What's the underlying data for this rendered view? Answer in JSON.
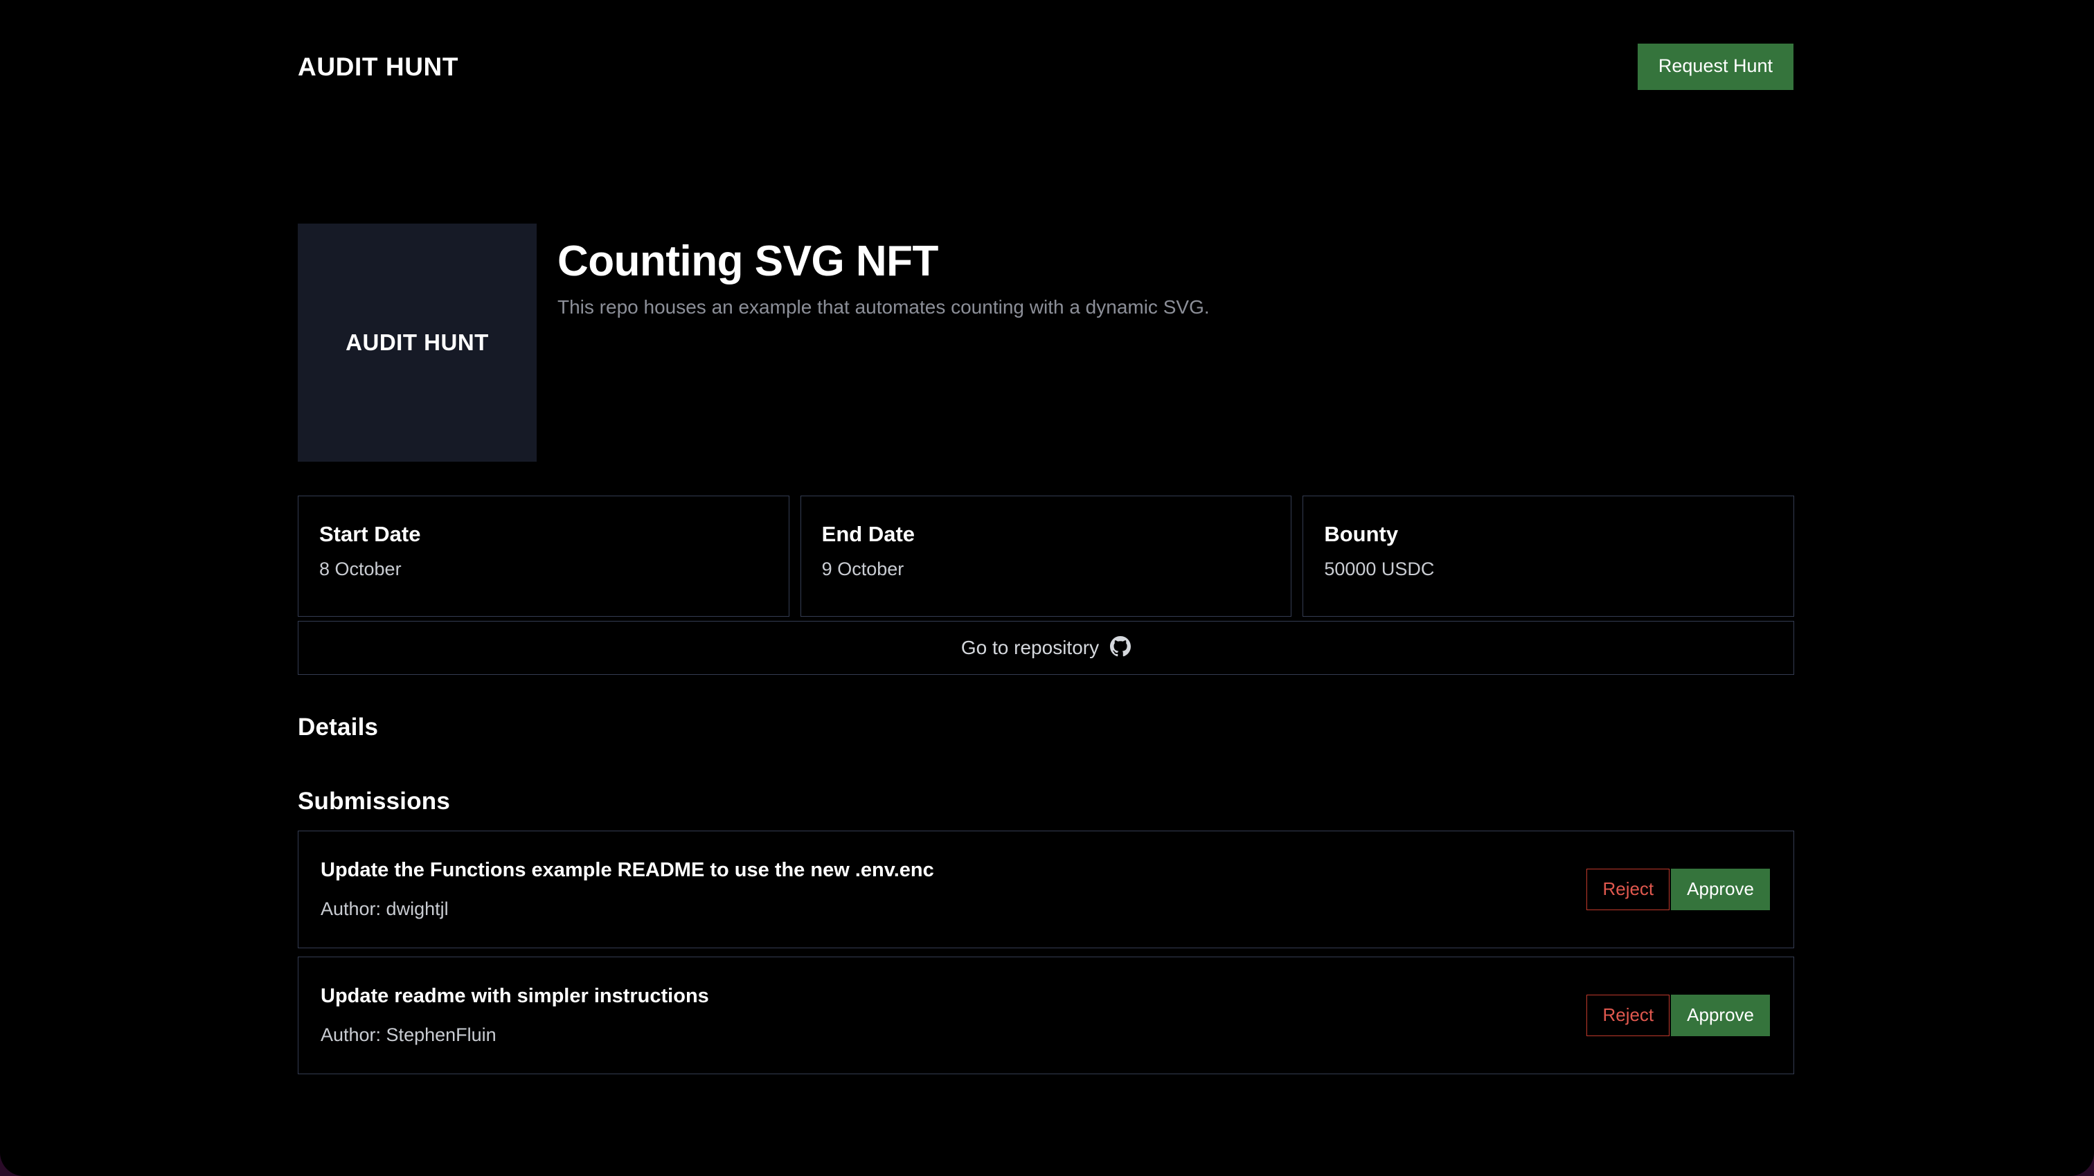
{
  "header": {
    "brand": "AUDIT HUNT",
    "request_hunt_label": "Request Hunt"
  },
  "hero": {
    "thumbnail_text": "AUDIT HUNT",
    "title": "Counting SVG NFT",
    "description": "This repo houses an example that automates counting with a dynamic SVG."
  },
  "meta_cards": [
    {
      "label": "Start Date",
      "value": "8 October"
    },
    {
      "label": "End Date",
      "value": "9 October"
    },
    {
      "label": "Bounty",
      "value": "50000 USDC"
    }
  ],
  "repository": {
    "label": "Go to repository",
    "icon": "github-icon"
  },
  "sections": {
    "details_heading": "Details",
    "submissions_heading": "Submissions"
  },
  "submissions": [
    {
      "title": "Update the Functions example README to use the new .env.enc",
      "author": "Author: dwightjl",
      "reject_label": "Reject",
      "approve_label": "Approve"
    },
    {
      "title": "Update readme with simpler instructions",
      "author": "Author: StephenFluin",
      "reject_label": "Reject",
      "approve_label": "Approve"
    }
  ],
  "colors": {
    "background": "#000000",
    "accent_green": "#35743c",
    "reject_red": "#e0584e",
    "card_border": "#343c52",
    "thumbnail_bg": "#161a26",
    "muted_text": "#8c8f98",
    "window_backdrop": "#2a0b28"
  }
}
